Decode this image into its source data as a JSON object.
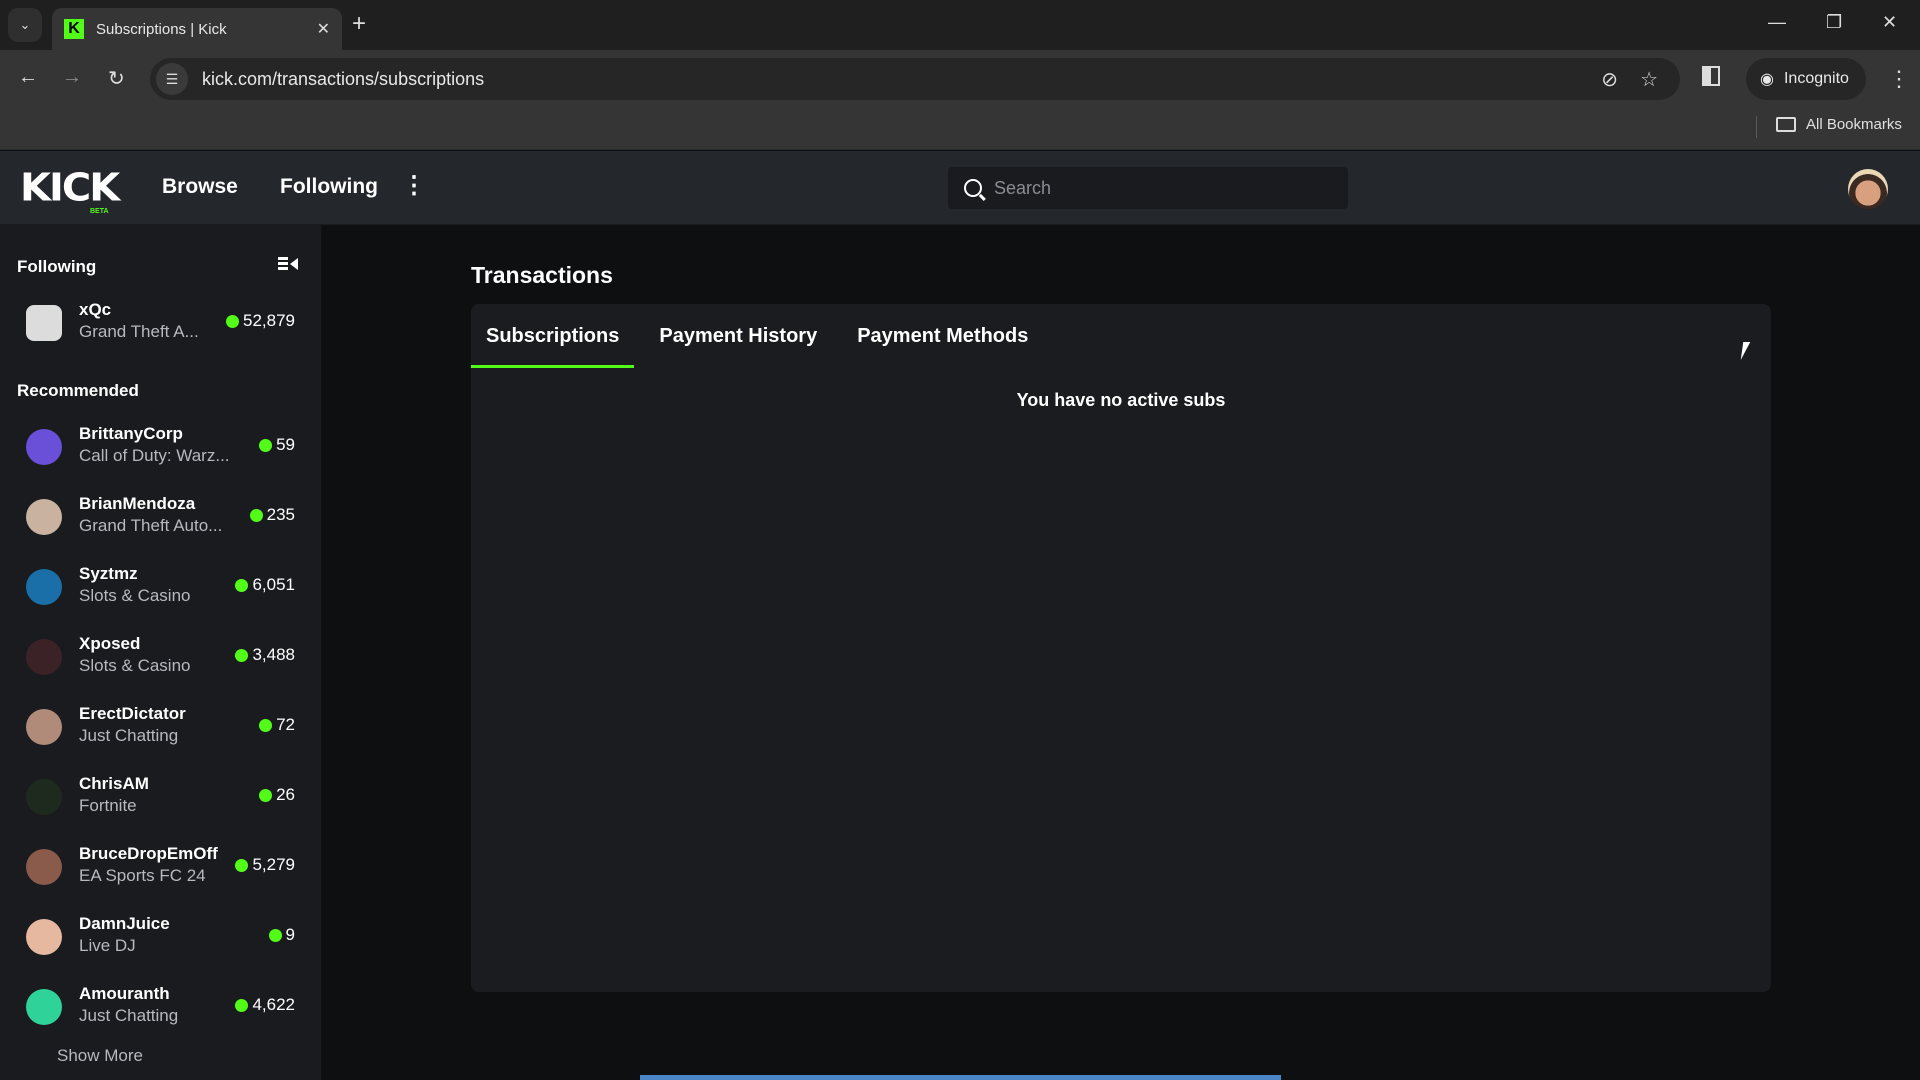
{
  "browser": {
    "tab_title": "Subscriptions | Kick",
    "tab_favicon": "K",
    "url": "kick.com/transactions/subscriptions",
    "incognito_label": "Incognito",
    "bookmarks_label": "All Bookmarks"
  },
  "header": {
    "logo": "KICK",
    "logo_badge": "BETA",
    "nav": [
      "Browse",
      "Following"
    ],
    "search_placeholder": "Search"
  },
  "sidebar": {
    "following_heading": "Following",
    "following": [
      {
        "name": "xQc",
        "category": "Grand Theft A...",
        "viewers": "52,879"
      }
    ],
    "recommended_heading": "Recommended",
    "recommended": [
      {
        "name": "BrittanyCorp",
        "category": "Call of Duty: Warz...",
        "viewers": "59"
      },
      {
        "name": "BrianMendoza",
        "category": "Grand Theft Auto...",
        "viewers": "235"
      },
      {
        "name": "Syztmz",
        "category": "Slots & Casino",
        "viewers": "6,051"
      },
      {
        "name": "Xposed",
        "category": "Slots & Casino",
        "viewers": "3,488"
      },
      {
        "name": "ErectDictator",
        "category": "Just Chatting",
        "viewers": "72"
      },
      {
        "name": "ChrisAM",
        "category": "Fortnite",
        "viewers": "26"
      },
      {
        "name": "BruceDropEmOff",
        "category": "EA Sports FC 24",
        "viewers": "5,279"
      },
      {
        "name": "DamnJuice",
        "category": "Live DJ",
        "viewers": "9"
      },
      {
        "name": "Amouranth",
        "category": "Just Chatting",
        "viewers": "4,622"
      }
    ],
    "show_more": "Show More"
  },
  "main": {
    "title": "Transactions",
    "tabs": [
      {
        "label": "Subscriptions",
        "active": true
      },
      {
        "label": "Payment History",
        "active": false
      },
      {
        "label": "Payment Methods",
        "active": false
      }
    ],
    "empty_message": "You have no active subs"
  },
  "colors": {
    "accent": "#53fc18",
    "header_bg": "#24272c",
    "sidebar_bg": "#191b1f",
    "page_bg": "#0e0f11",
    "card_bg": "#1b1c20"
  }
}
